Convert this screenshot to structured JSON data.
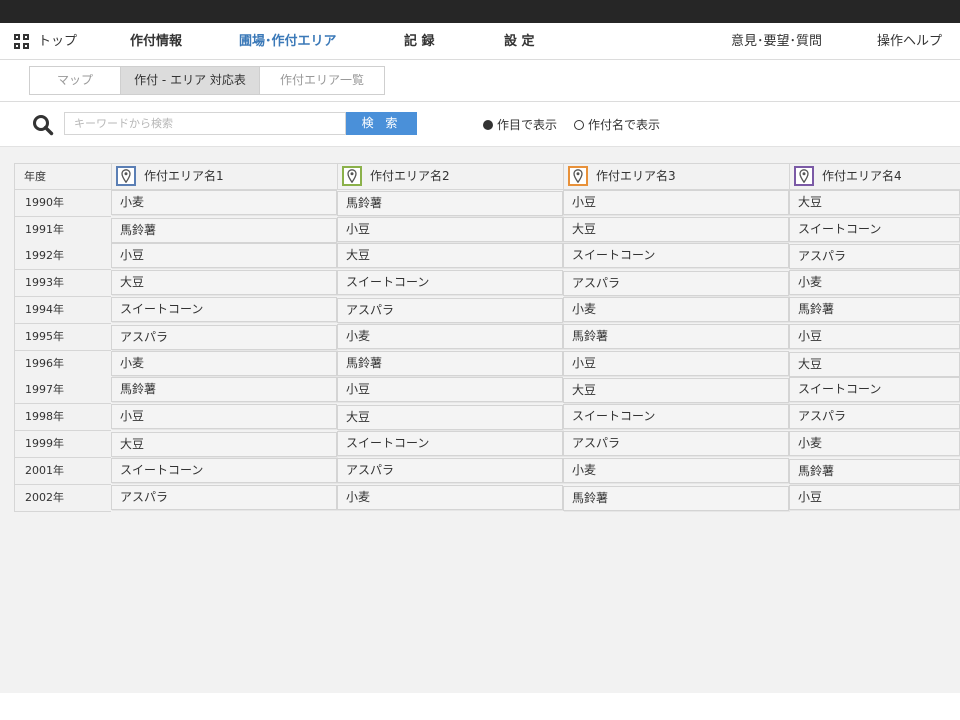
{
  "nav": {
    "items": [
      {
        "label": "トップ"
      },
      {
        "label": "作付情報"
      },
      {
        "label": "圃場･作付エリア"
      },
      {
        "label": "記 録"
      },
      {
        "label": "設 定"
      },
      {
        "label": "意見･要望･質問"
      },
      {
        "label": "操作ヘルプ"
      }
    ]
  },
  "subtabs": [
    {
      "label": "マップ"
    },
    {
      "label": "作付 - エリア 対応表"
    },
    {
      "label": "作付エリア一覧"
    }
  ],
  "search": {
    "value": "",
    "placeholder": "キーワードから検索",
    "button_label": "検 索",
    "radio_crop_label": "作目で表示",
    "radio_name_label": "作付名で表示",
    "selected": "crop"
  },
  "table": {
    "year_header": "年度",
    "areas": [
      {
        "name": "作付エリア名1",
        "color": "#5b7fb5"
      },
      {
        "name": "作付エリア名2",
        "color": "#8bb14a"
      },
      {
        "name": "作付エリア名3",
        "color": "#e8913a"
      },
      {
        "name": "作付エリア名4",
        "color": "#7b5aa6"
      }
    ],
    "rows": [
      {
        "year": "1990年",
        "cells": [
          "小麦",
          "馬鈴薯",
          "小豆",
          "大豆"
        ]
      },
      {
        "year": "1991年",
        "cells": [
          "馬鈴薯",
          "小豆",
          "大豆",
          "スイートコーン"
        ]
      },
      {
        "year": "1992年",
        "cells": [
          "小豆",
          "大豆",
          "スイートコーン",
          "アスパラ"
        ]
      },
      {
        "year": "1993年",
        "cells": [
          "大豆",
          "スイートコーン",
          "アスパラ",
          "小麦"
        ]
      },
      {
        "year": "1994年",
        "cells": [
          "スイートコーン",
          "アスパラ",
          "小麦",
          "馬鈴薯"
        ]
      },
      {
        "year": "1995年",
        "cells": [
          "アスパラ",
          "小麦",
          "馬鈴薯",
          "小豆"
        ]
      },
      {
        "year": "1996年",
        "cells": [
          "小麦",
          "馬鈴薯",
          "小豆",
          "大豆"
        ]
      },
      {
        "year": "1997年",
        "cells": [
          "馬鈴薯",
          "小豆",
          "大豆",
          "スイートコーン"
        ]
      },
      {
        "year": "1998年",
        "cells": [
          "小豆",
          "大豆",
          "スイートコーン",
          "アスパラ"
        ]
      },
      {
        "year": "1999年",
        "cells": [
          "大豆",
          "スイートコーン",
          "アスパラ",
          "小麦"
        ]
      },
      {
        "year": "2001年",
        "cells": [
          "スイートコーン",
          "アスパラ",
          "小麦",
          "馬鈴薯"
        ]
      },
      {
        "year": "2002年",
        "cells": [
          "アスパラ",
          "小麦",
          "馬鈴薯",
          "小豆"
        ]
      }
    ]
  }
}
